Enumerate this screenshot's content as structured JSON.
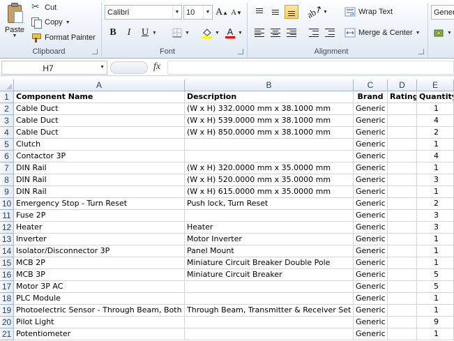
{
  "ribbon": {
    "clipboard": {
      "paste_label": "Paste",
      "cut_label": "Cut",
      "copy_label": "Copy",
      "format_painter_label": "Format Painter",
      "group_label": "Clipboard"
    },
    "font": {
      "font_name": "Calibri",
      "font_size": "10",
      "group_label": "Font",
      "bold_label": "B",
      "italic_label": "I",
      "underline_label": "U",
      "grow_label": "A",
      "shrink_label": "A",
      "font_color_label": "A",
      "highlight_color": "#ffff00",
      "font_color": "#ff0000"
    },
    "alignment": {
      "wrap_text_label": "Wrap Text",
      "merge_center_label": "Merge & Center",
      "group_label": "Alignment"
    },
    "number": {
      "format_value": "Gener"
    }
  },
  "formula_bar": {
    "name_box": "H7",
    "fx_label": "fx",
    "formula": ""
  },
  "grid": {
    "columns": [
      "A",
      "B",
      "C",
      "D",
      "E"
    ],
    "rows": [
      {
        "n": "1",
        "a": "Component Name",
        "b": "Description",
        "c": "Brand",
        "d": "Rating",
        "e": "Quantity"
      },
      {
        "n": "2",
        "a": "Cable Duct",
        "b": "(W x H) 332.0000 mm x 38.1000 mm",
        "c": "Generic",
        "d": "",
        "e": "1"
      },
      {
        "n": "3",
        "a": "Cable Duct",
        "b": "(W x H) 539.0000 mm x 38.1000 mm",
        "c": "Generic",
        "d": "",
        "e": "4"
      },
      {
        "n": "4",
        "a": "Cable Duct",
        "b": "(W x H) 850.0000 mm x 38.1000 mm",
        "c": "Generic",
        "d": "",
        "e": "2"
      },
      {
        "n": "5",
        "a": "Clutch",
        "b": "",
        "c": "Generic",
        "d": "",
        "e": "1"
      },
      {
        "n": "6",
        "a": "Contactor 3P",
        "b": "",
        "c": "Generic",
        "d": "",
        "e": "4"
      },
      {
        "n": "7",
        "a": "DIN Rail",
        "b": "(W x H) 320.0000 mm x 35.0000 mm",
        "c": "Generic",
        "d": "",
        "e": "1"
      },
      {
        "n": "8",
        "a": "DIN Rail",
        "b": "(W x H) 520.0000 mm x 35.0000 mm",
        "c": "Generic",
        "d": "",
        "e": "3"
      },
      {
        "n": "9",
        "a": "DIN Rail",
        "b": "(W x H) 615.0000 mm x 35.0000 mm",
        "c": "Generic",
        "d": "",
        "e": "1"
      },
      {
        "n": "10",
        "a": "Emergency Stop - Turn Reset",
        "b": "Push lock, Turn Reset",
        "c": "Generic",
        "d": "",
        "e": "2"
      },
      {
        "n": "11",
        "a": "Fuse 2P",
        "b": "",
        "c": "Generic",
        "d": "",
        "e": "3"
      },
      {
        "n": "12",
        "a": "Heater",
        "b": "Heater",
        "c": "Generic",
        "d": "",
        "e": "3"
      },
      {
        "n": "13",
        "a": "Inverter",
        "b": "Motor Inverter",
        "c": "Generic",
        "d": "",
        "e": "1"
      },
      {
        "n": "14",
        "a": "Isolator/Disconnector 3P",
        "b": "Panel Mount",
        "c": "Generic",
        "d": "",
        "e": "1"
      },
      {
        "n": "15",
        "a": "MCB 2P",
        "b": "Miniature Circuit Breaker Double Pole",
        "c": "Generic",
        "d": "",
        "e": "1"
      },
      {
        "n": "16",
        "a": "MCB 3P",
        "b": "Miniature Circuit Breaker",
        "c": "Generic",
        "d": "",
        "e": "5"
      },
      {
        "n": "17",
        "a": "Motor 3P AC",
        "b": "",
        "c": "Generic",
        "d": "",
        "e": "5"
      },
      {
        "n": "18",
        "a": "PLC Module",
        "b": "",
        "c": "Generic",
        "d": "",
        "e": "1"
      },
      {
        "n": "19",
        "a": "Photoelectric Sensor - Through Beam, Both",
        "b": "Through Beam, Transmitter & Receiver Set",
        "c": "Generic",
        "d": "",
        "e": "1"
      },
      {
        "n": "20",
        "a": "Pilot Light",
        "b": "",
        "c": "Generic",
        "d": "",
        "e": "9"
      },
      {
        "n": "21",
        "a": "Potentiometer",
        "b": "",
        "c": "Generic",
        "d": "",
        "e": "1"
      }
    ]
  }
}
